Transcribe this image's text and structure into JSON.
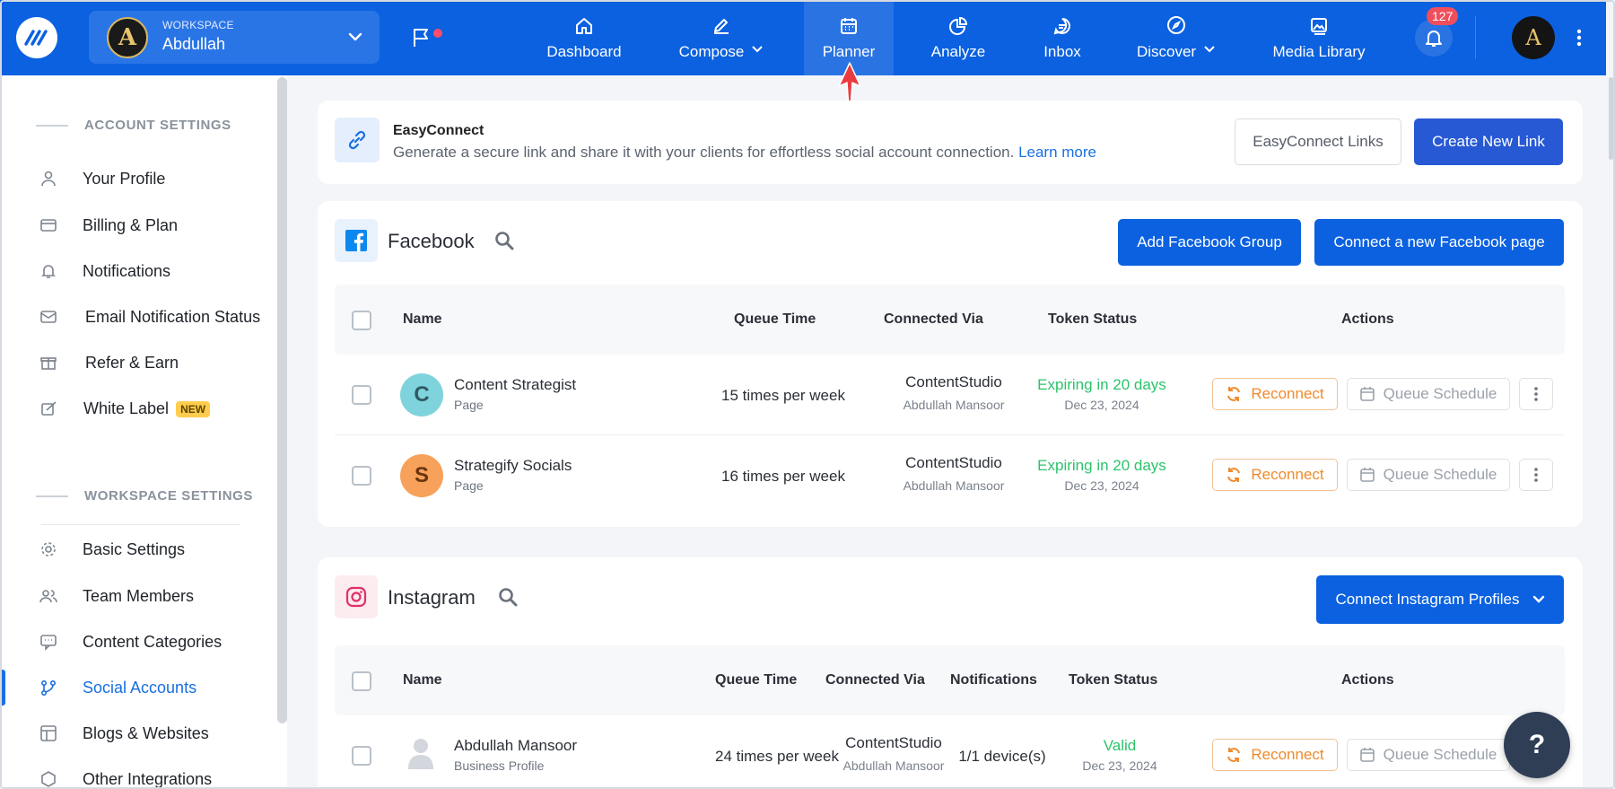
{
  "topbar": {
    "workspace_caption": "WORKSPACE",
    "workspace_name": "Abdullah",
    "workspace_initial": "A",
    "nav": [
      {
        "label": "Dashboard"
      },
      {
        "label": "Compose"
      },
      {
        "label": "Planner"
      },
      {
        "label": "Analyze"
      },
      {
        "label": "Inbox"
      },
      {
        "label": "Discover"
      },
      {
        "label": "Media Library"
      }
    ],
    "notification_count": "127",
    "user_initial": "A",
    "accent": "#0b61e0"
  },
  "sidebar": {
    "account_title": "ACCOUNT SETTINGS",
    "account_items": [
      {
        "label": "Your Profile",
        "icon": "user-icon"
      },
      {
        "label": "Billing & Plan",
        "icon": "credit-card-icon"
      },
      {
        "label": "Notifications",
        "icon": "bell-icon"
      },
      {
        "label": "Email Notification Status",
        "icon": "mail-icon"
      },
      {
        "label": "Refer & Earn",
        "icon": "gift-icon"
      },
      {
        "label": "White Label",
        "icon": "white-label-icon",
        "badge": "NEW"
      }
    ],
    "workspace_title": "WORKSPACE SETTINGS",
    "workspace_items": [
      {
        "label": "Basic Settings",
        "icon": "gear-icon"
      },
      {
        "label": "Team Members",
        "icon": "users-icon"
      },
      {
        "label": "Content Categories",
        "icon": "categories-icon"
      },
      {
        "label": "Social Accounts",
        "icon": "share-icon",
        "active": true
      },
      {
        "label": "Blogs & Websites",
        "icon": "layout-icon"
      },
      {
        "label": "Other Integrations",
        "icon": "hexagon-icon"
      }
    ]
  },
  "easyconnect": {
    "title": "EasyConnect",
    "description": "Generate a secure link and share it with your clients for effortless social account connection.",
    "learn_more": "Learn more",
    "links_button": "EasyConnect Links",
    "create_button": "Create New Link"
  },
  "facebook": {
    "title": "Facebook",
    "add_group_button": "Add Facebook Group",
    "connect_button": "Connect a new Facebook page",
    "columns": {
      "name": "Name",
      "queue": "Queue Time",
      "via": "Connected Via",
      "token": "Token Status",
      "actions": "Actions"
    },
    "rows": [
      {
        "initial": "C",
        "name": "Content Strategist",
        "type": "Page",
        "queue": "15 times per week",
        "via": "ContentStudio",
        "via_user": "Abdullah Mansoor",
        "status": "Expiring in 20 days",
        "status_date": "Dec 23, 2024",
        "avatar_color": "#7fd3dc"
      },
      {
        "initial": "S",
        "name": "Strategify Socials",
        "type": "Page",
        "queue": "16 times per week",
        "via": "ContentStudio",
        "via_user": "Abdullah Mansoor",
        "status": "Expiring in 20 days",
        "status_date": "Dec 23, 2024",
        "avatar_color": "#f7a15a"
      }
    ],
    "reconnect_label": "Reconnect",
    "queue_label": "Queue Schedule"
  },
  "instagram": {
    "title": "Instagram",
    "connect_button": "Connect Instagram Profiles",
    "columns": {
      "name": "Name",
      "queue": "Queue Time",
      "via": "Connected Via",
      "notifications": "Notifications",
      "token": "Token Status",
      "actions": "Actions"
    },
    "rows": [
      {
        "name": "Abdullah Mansoor",
        "type": "Business Profile",
        "queue": "24 times per week",
        "via": "ContentStudio",
        "via_user": "Abdullah Mansoor",
        "notifications": "1/1 device(s)",
        "status": "Valid",
        "status_date": "Dec 23, 2024"
      }
    ],
    "reconnect_label": "Reconnect",
    "queue_label": "Queue Schedule"
  },
  "help_label": "?"
}
